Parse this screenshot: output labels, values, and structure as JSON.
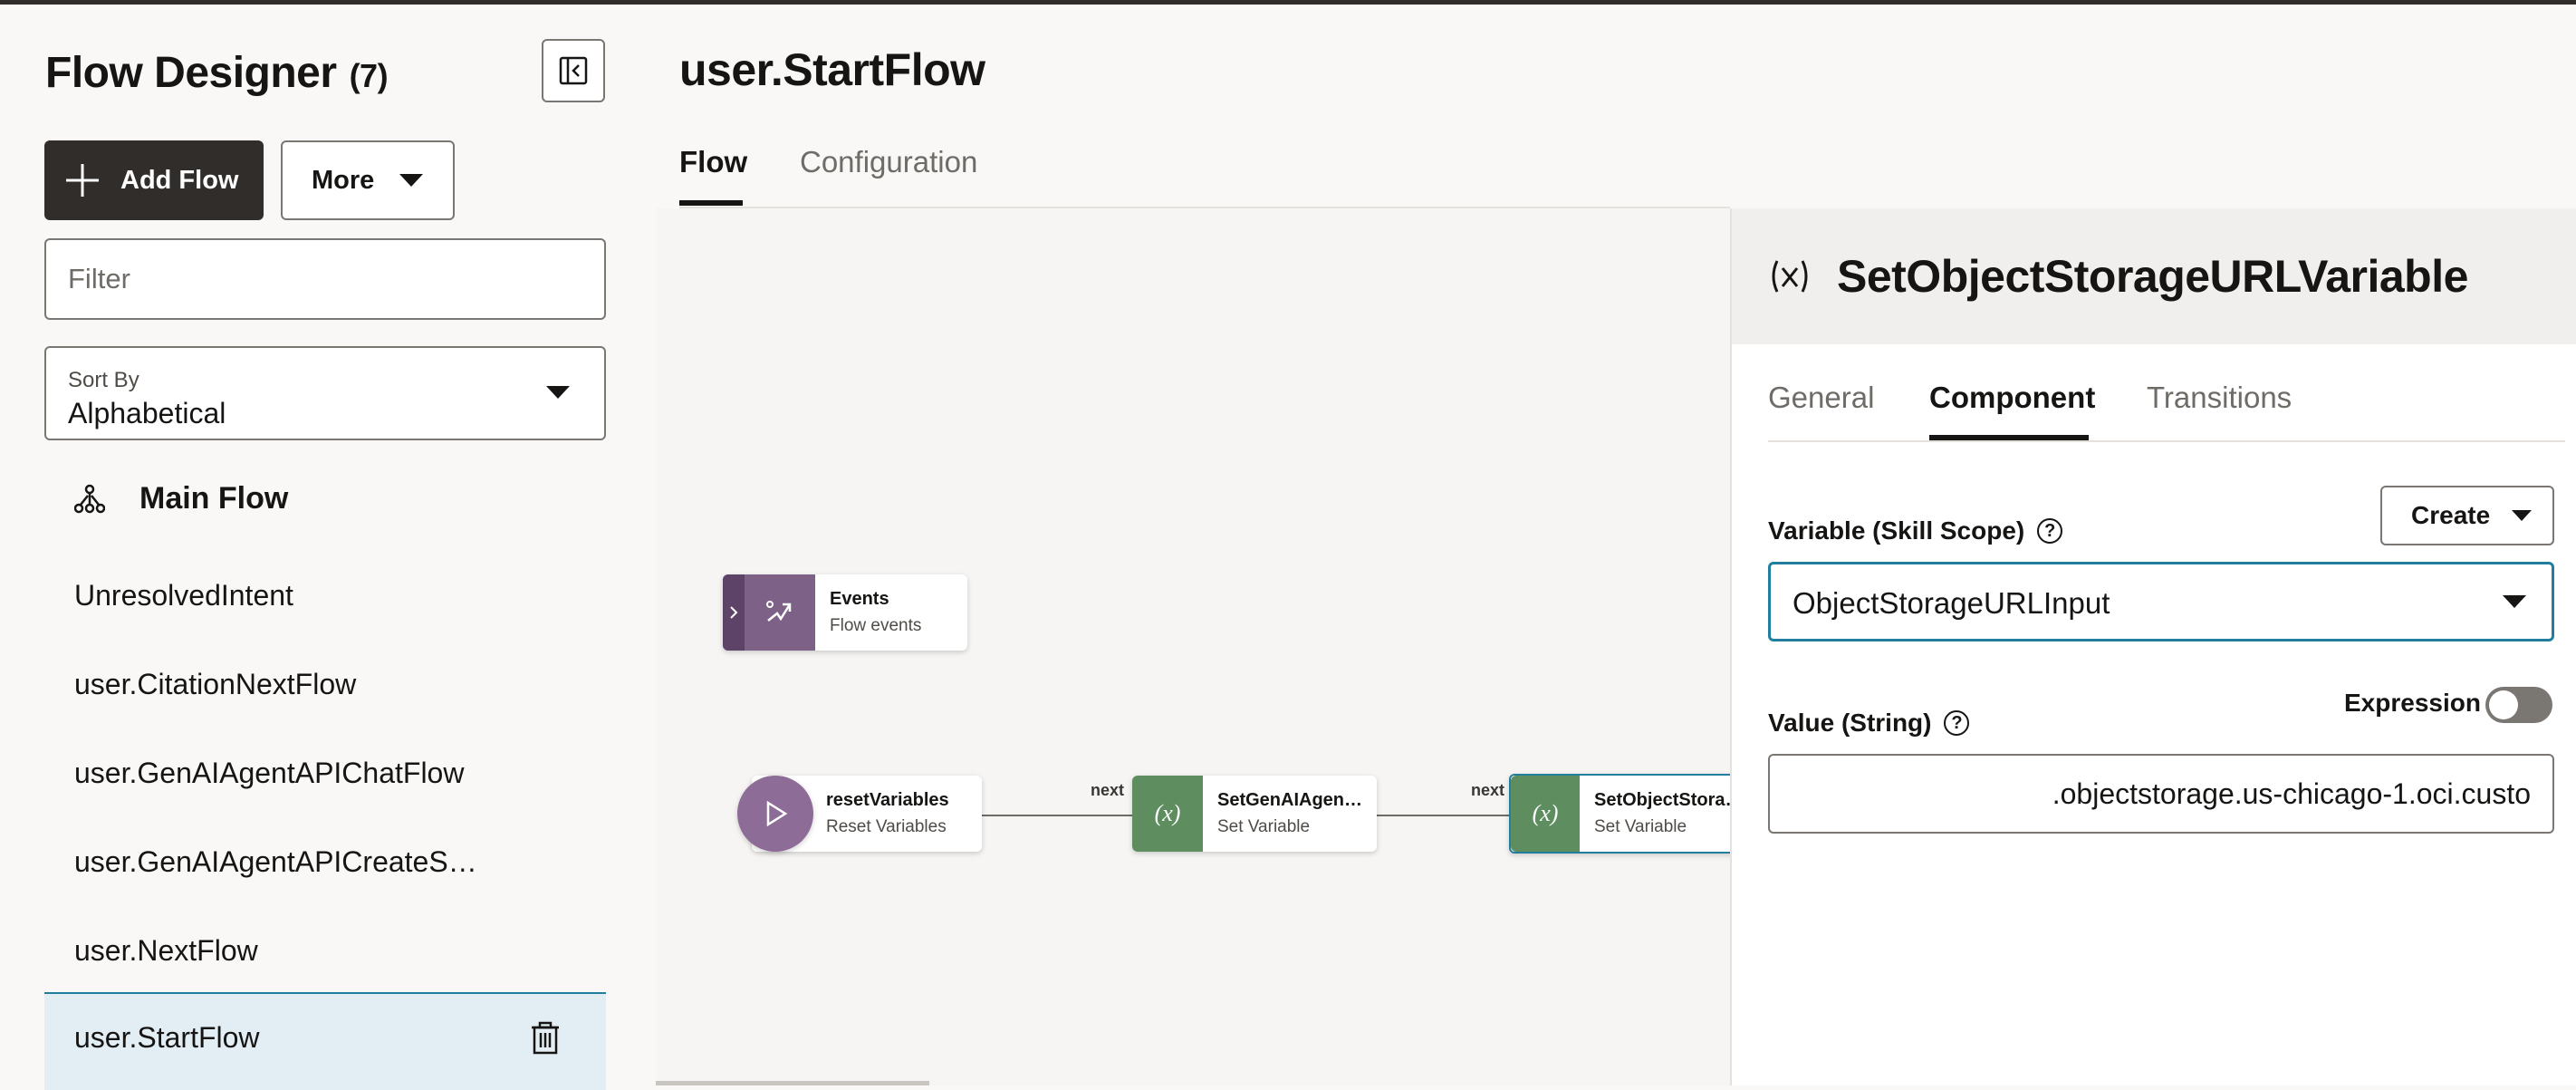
{
  "sidebar": {
    "title": "Flow Designer",
    "count": "(7)",
    "add_flow_label": "Add Flow",
    "more_label": "More",
    "filter_placeholder": "Filter",
    "sort_by_label": "Sort By",
    "sort_by_value": "Alphabetical",
    "main_flow_label": "Main Flow",
    "flows": [
      "UnresolvedIntent",
      "user.CitationNextFlow",
      "user.GenAIAgentAPIChatFlow",
      "user.GenAIAgentAPICreateS…",
      "user.NextFlow"
    ],
    "selected_flow": "user.StartFlow"
  },
  "main": {
    "title": "user.StartFlow",
    "tabs": [
      "Flow",
      "Configuration"
    ],
    "active_tab": "Flow"
  },
  "canvas": {
    "nodes": {
      "events": {
        "title": "Events",
        "subtitle": "Flow events"
      },
      "reset": {
        "title": "resetVariables",
        "subtitle": "Reset Variables"
      },
      "setgenai": {
        "title": "SetGenAIAgen…",
        "subtitle": "Set Variable"
      },
      "setobject": {
        "title": "SetObjectStora…",
        "subtitle": "Set Variable"
      }
    },
    "edge_label": "next"
  },
  "panel": {
    "title": "SetObjectStorageURLVariable",
    "tabs": [
      "General",
      "Component",
      "Transitions"
    ],
    "active_tab": "Component",
    "variable_label": "Variable (Skill Scope)",
    "create_label": "Create",
    "variable_value": "ObjectStorageURLInput",
    "value_label": "Value (String)",
    "expression_label": "Expression",
    "expression_on": false,
    "value_text": ".objectstorage.us-chicago-1.oci.custo"
  },
  "colors": {
    "accent": "#227e9e",
    "dark": "#312d2a",
    "node_purple": "#8d6d97",
    "node_green": "#5e8e5f"
  }
}
